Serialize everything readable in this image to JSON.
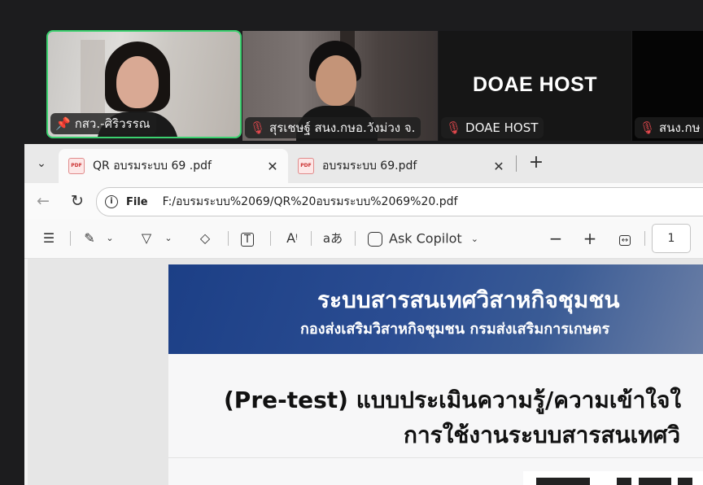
{
  "meeting": {
    "participants": [
      {
        "name": "กสว.-ศิริวรรณ",
        "icon": "pin-icon",
        "active_speaker": true
      },
      {
        "name": "สุรเชษฐ์ สนง.กษอ.วังม่วง จ.",
        "icon": "mic-muted-icon"
      },
      {
        "name": "DOAE HOST",
        "display_text": "DOAE HOST",
        "icon": "mic-muted-icon"
      },
      {
        "name": "สนง.กษ",
        "icon": "mic-muted-icon"
      }
    ]
  },
  "browser": {
    "tabs": [
      {
        "title": "QR อบรมระบบ 69 .pdf",
        "active": true
      },
      {
        "title": "อบรมระบบ 69.pdf",
        "active": false
      }
    ],
    "address": {
      "scheme_label": "File",
      "url": "F:/อบรมระบบ%2069/QR%20อบรมระบบ%2069%20.pdf"
    },
    "pdf_toolbar": {
      "ask_copilot": "Ask Copilot",
      "page_number": "1",
      "read_aloud_label": "A",
      "translate_label": "aあ"
    }
  },
  "document": {
    "banner_title": "ระบบสารสนเทศวิสาหกิจชุมชน",
    "banner_subtitle": "กองส่งเสริมวิสาหกิจชุมชน กรมส่งเสริมการเกษตร",
    "heading_line1": "(Pre-test) แบบประเมินความรู้/ความเข้าใจใ",
    "heading_line2": "การใช้งานระบบสารสนเทศวิ"
  },
  "colors": {
    "active_speaker_border": "#3bd16f",
    "muted": "#e5484d",
    "banner": "#2b4d92"
  }
}
